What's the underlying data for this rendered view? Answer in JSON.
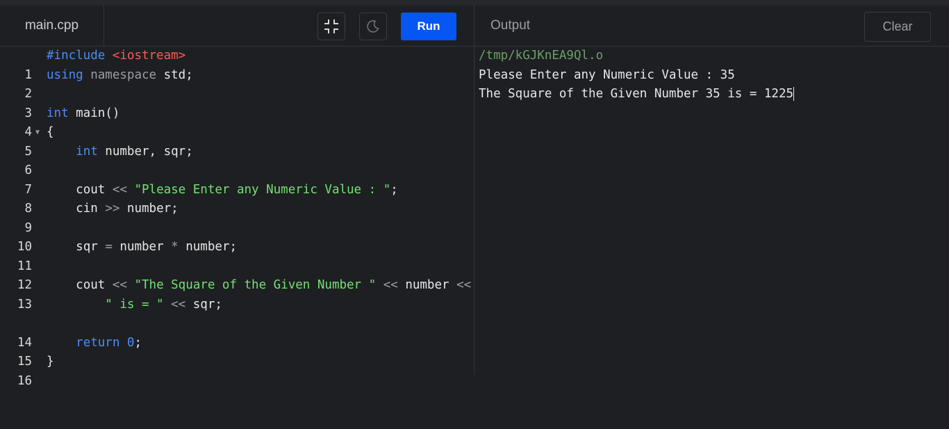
{
  "editor": {
    "tab_label": "main.cpp",
    "run_label": "Run",
    "lines": [
      {
        "n": "1"
      },
      {
        "n": "2"
      },
      {
        "n": "3"
      },
      {
        "n": "4"
      },
      {
        "n": "5"
      },
      {
        "n": "6"
      },
      {
        "n": "7"
      },
      {
        "n": "8"
      },
      {
        "n": "9"
      },
      {
        "n": "10"
      },
      {
        "n": "11"
      },
      {
        "n": "12"
      },
      {
        "n": "13"
      },
      {
        "n": "14"
      },
      {
        "n": "15"
      },
      {
        "n": "16"
      }
    ],
    "code": {
      "l1_kw": "#include",
      "l1_inc": "<iostream>",
      "l2_kw": "using",
      "l2_ns": "namespace",
      "l2_rest": " std;",
      "l4_kw": "int",
      "l4_rest": " main()",
      "l5": "{",
      "l6_kw": "int",
      "l6_rest": " number, sqr;",
      "l8_a": "cout ",
      "l8_op": "<<",
      "l8_str": "\"Please Enter any Numeric Value : \"",
      "l8_end": ";",
      "l9_a": "cin ",
      "l9_op": ">>",
      "l9_b": " number;",
      "l11_a": "sqr ",
      "l11_op1": "=",
      "l11_b": " number ",
      "l11_op2": "*",
      "l11_c": " number;",
      "l13_a": "cout ",
      "l13_op1": "<<",
      "l13_str1": "\"The Square of the Given Number \"",
      "l13_op2": "<<",
      "l13_b": " number ",
      "l13_op3": "<<",
      "l13_str2": "\" is = \"",
      "l13_op4": "<<",
      "l13_c": " sqr;",
      "l15_kw": "return",
      "l15_num": "0",
      "l15_end": ";",
      "l16": "}"
    }
  },
  "output": {
    "label": "Output",
    "clear_label": "Clear",
    "lines": [
      "/tmp/kGJKnEA9Ql.o",
      "Please Enter any Numeric Value : 35",
      "The Square of the Given Number 35 is = 1225"
    ]
  },
  "colors": {
    "background": "#1e1f22",
    "run_button": "#0556f3",
    "keyword": "#4c8df6",
    "string": "#73e173",
    "include": "#ff5a52"
  },
  "icons": [
    "collapse-icon",
    "moon-icon",
    "fold-arrow-icon"
  ]
}
